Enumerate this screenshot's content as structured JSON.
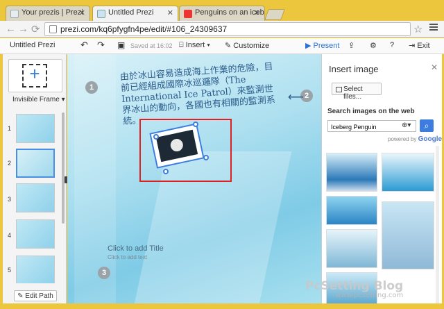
{
  "browser": {
    "tabs": [
      {
        "title": "Your prezis | Prezi",
        "active": false
      },
      {
        "title": "Untitled Prezi",
        "active": true
      },
      {
        "title": "Penguins on an iceberg",
        "active": false
      }
    ],
    "url": "prezi.com/kq6pfygfn4pe/edit/#106_24309637"
  },
  "appbar": {
    "title": "Untitled Prezi",
    "saved": "Saved at 16:02",
    "insert": "Insert",
    "customize": "Customize",
    "present": "Present",
    "exit": "Exit"
  },
  "left": {
    "frame_label": "Invisible Frame",
    "thumbs": [
      "1",
      "2",
      "3",
      "4",
      "5"
    ],
    "edit_path": "Edit Path"
  },
  "canvas": {
    "text": "由於冰山容易造成海上作業的危險，目前已經組成國際冰巡邏隊（The International Ice Patrol）來監測世界冰山的動向，各國也有相關的監測系統。",
    "steps": [
      "1",
      "2",
      "3"
    ],
    "add_title": "Click to add Title",
    "add_subtitle": "Click to add text"
  },
  "panel": {
    "title": "Insert image",
    "select_files": "Select files...",
    "search_label": "Search images on the web",
    "search_value": "Iceberg Penguin",
    "powered_by": "powered by",
    "provider": "Google"
  },
  "colors": {
    "accent": "#3d7de0",
    "highlight": "#e02020",
    "frame": "#ecc63c"
  },
  "watermark": {
    "title": "PcSetting Blog",
    "url": "www.pcsetting.com"
  }
}
